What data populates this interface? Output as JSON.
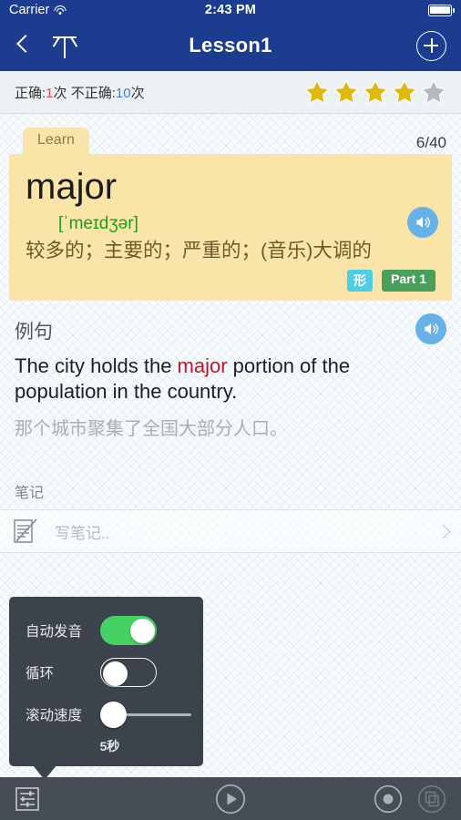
{
  "status_bar": {
    "carrier": "Carrier",
    "wifi_icon": "wifi-icon",
    "time": "2:43 PM",
    "battery_icon": "battery-full-icon"
  },
  "nav_bar": {
    "back_icon": "chevron-left-icon",
    "up_icon": "up-arrow-icon",
    "title": "Lesson1",
    "add_icon": "plus-circle-icon",
    "background": "#1c3d8f"
  },
  "stats": {
    "correct_label": "正确:",
    "correct_count": "1",
    "correct_unit": "次",
    "incorrect_label": "不正确:",
    "incorrect_count": "10",
    "incorrect_unit": "次",
    "correct_color": "#e8455b",
    "incorrect_color": "#3d7de0",
    "stars_filled": 4,
    "stars_total": 5,
    "star_on_color": "#e0b90a",
    "star_off_color": "#b6b9bc"
  },
  "card": {
    "tab_label": "Learn",
    "counter": "6/40",
    "word": "major",
    "phonetic": "[ˈmeɪdʒər]",
    "definition": "较多的；主要的；严重的；(音乐)大调的",
    "pos_badge": "形",
    "part_badge": "Part 1",
    "speaker_icon": "speaker-icon",
    "background": "#fbe4a8",
    "pos_badge_color": "#4ecde6",
    "part_badge_color": "#48a05a",
    "phonetic_color": "#11a31a"
  },
  "example": {
    "section_title": "例句",
    "speaker_icon": "speaker-icon",
    "sentence_before": "The city holds the ",
    "sentence_highlight": "major",
    "sentence_after": " portion of the population in the country.",
    "highlight_color": "#c0182b",
    "translation": "那个城市聚集了全国大部分人口。"
  },
  "notes": {
    "label": "笔记",
    "note_icon": "note-pencil-icon",
    "placeholder": "写笔记..",
    "chevron_icon": "chevron-right-icon"
  },
  "settings_popover": {
    "rows": [
      {
        "label": "自动发音",
        "control": "toggle",
        "state": "on"
      },
      {
        "label": "循环",
        "control": "toggle",
        "state": "off"
      },
      {
        "label": "滚动速度",
        "control": "slider",
        "value": "5秒",
        "position_pct": 0
      }
    ],
    "speed_value": "5秒",
    "background": "#3c434d",
    "toggle_on_color": "#45d263"
  },
  "toolbar": {
    "settings_icon": "sliders-icon",
    "play_icon": "play-circle-icon",
    "record_icon": "record-circle-icon",
    "cards_icon": "copy-cards-icon",
    "background": "#464d57"
  }
}
